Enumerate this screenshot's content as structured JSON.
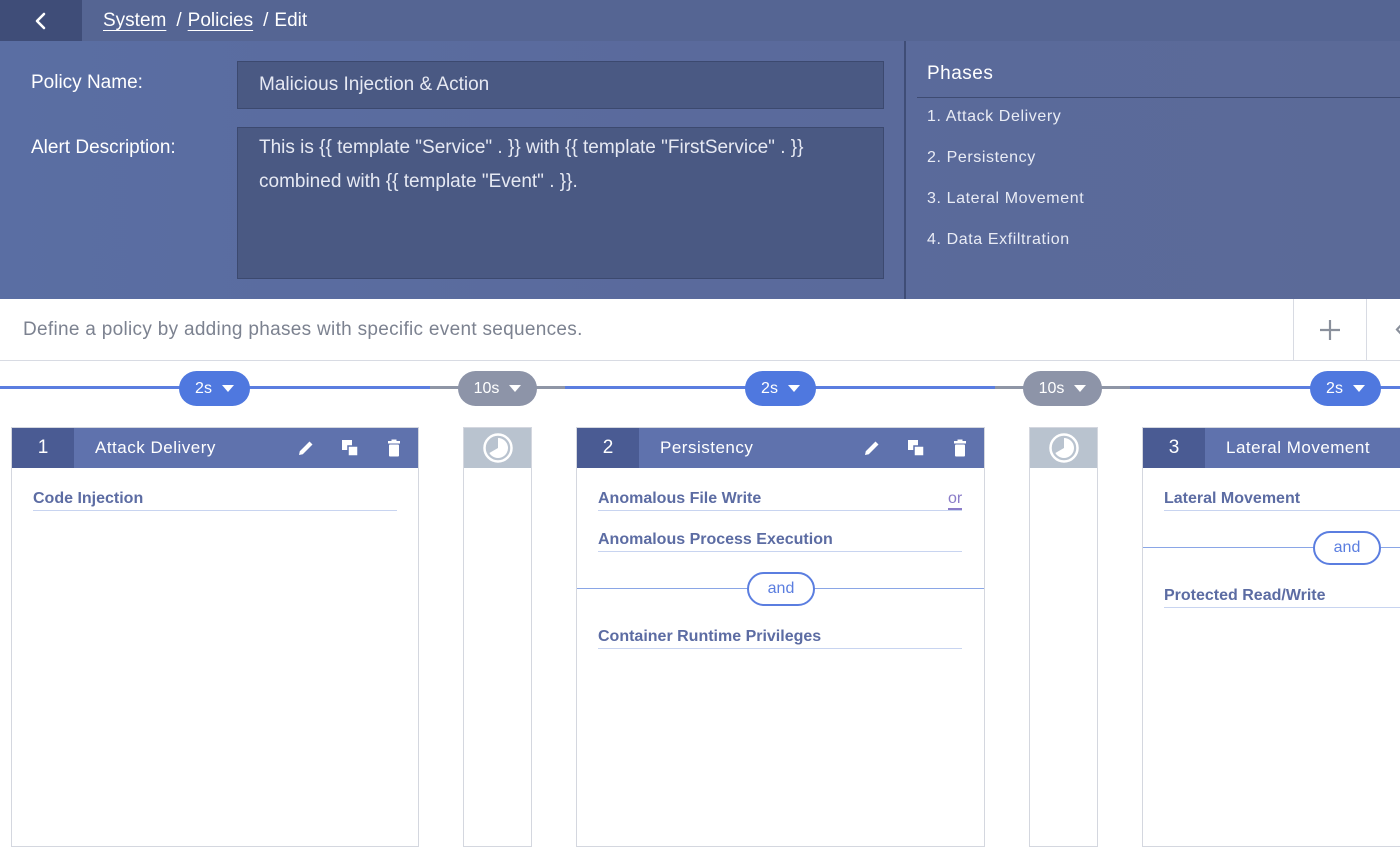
{
  "breadcrumb": {
    "system": "System",
    "sep1": "/",
    "policies": "Policies",
    "sep2": "/",
    "edit": "Edit"
  },
  "form": {
    "policy_name_label": "Policy Name:",
    "policy_name_value": "Malicious Injection & Action",
    "alert_desc_label": "Alert Description:",
    "alert_desc_line1": "This is {{ template \"Service\" . }} with {{ template \"FirstService\" . }}",
    "alert_desc_line2": "combined with {{ template \"Event\" . }}."
  },
  "phases_panel": {
    "title": "Phases",
    "items": [
      "1. Attack Delivery",
      "2. Persistency",
      "3. Lateral Movement",
      "4. Data Exfiltration"
    ]
  },
  "hint": "Define a policy by adding phases with specific event sequences.",
  "timeline": {
    "pills": [
      "2s",
      "10s",
      "2s",
      "10s",
      "2s"
    ]
  },
  "cards": [
    {
      "number": "1",
      "title": "Attack Delivery",
      "events": [
        "Code Injection"
      ]
    },
    {
      "number": "2",
      "title": "Persistency",
      "events": [
        "Anomalous File Write",
        "Anomalous Process Execution",
        "Container Runtime Privileges"
      ],
      "or_label": "or",
      "and_label": "and"
    },
    {
      "number": "3",
      "title": "Lateral Movement",
      "events": [
        "Lateral Movement",
        "Protected Read/Write"
      ],
      "and_label": "and"
    }
  ],
  "colors": {
    "accent_blue": "#4f78df",
    "header_bg": "#5a6ea3",
    "card_header": "#5f72ad",
    "event_text": "#5c6ca3"
  },
  "icons": {
    "back": "chevron-left-icon",
    "edit": "pencil-icon",
    "copy": "copy-icon",
    "delete": "trash-icon",
    "add": "plus-icon",
    "timer": "clock-icon"
  }
}
